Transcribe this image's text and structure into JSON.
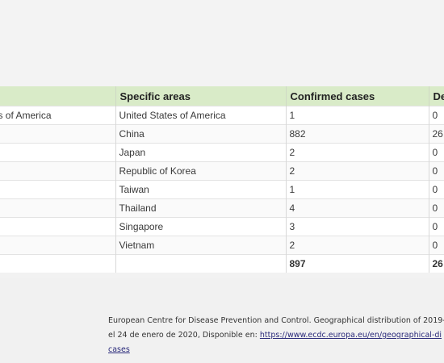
{
  "table": {
    "headers": [
      "Specific areas",
      "Confirmed cases",
      "De"
    ],
    "rows": [
      {
        "country": "s of America",
        "area": "United States of America",
        "cases": "1",
        "deaths": "0"
      },
      {
        "country": "",
        "area": "China",
        "cases": "882",
        "deaths": "26"
      },
      {
        "country": "",
        "area": "Japan",
        "cases": "2",
        "deaths": "0"
      },
      {
        "country": "",
        "area": "Republic of Korea",
        "cases": "2",
        "deaths": "0"
      },
      {
        "country": "",
        "area": "Taiwan",
        "cases": "1",
        "deaths": "0"
      },
      {
        "country": "",
        "area": "Thailand",
        "cases": "4",
        "deaths": "0"
      },
      {
        "country": "",
        "area": "Singapore",
        "cases": "3",
        "deaths": "0"
      },
      {
        "country": "",
        "area": "Vietnam",
        "cases": "2",
        "deaths": "0"
      }
    ],
    "total": {
      "cases": "897",
      "deaths": "26"
    }
  },
  "reference": {
    "line1": "European Centre for Disease Prevention and Control. Geographical distribution of 2019-",
    "line2_prefix": "el 24 de enero de 2020, Disponible en: ",
    "link_text": "https://www.ecdc.europa.eu/en/geographical-di",
    "link_cont": "cases"
  }
}
